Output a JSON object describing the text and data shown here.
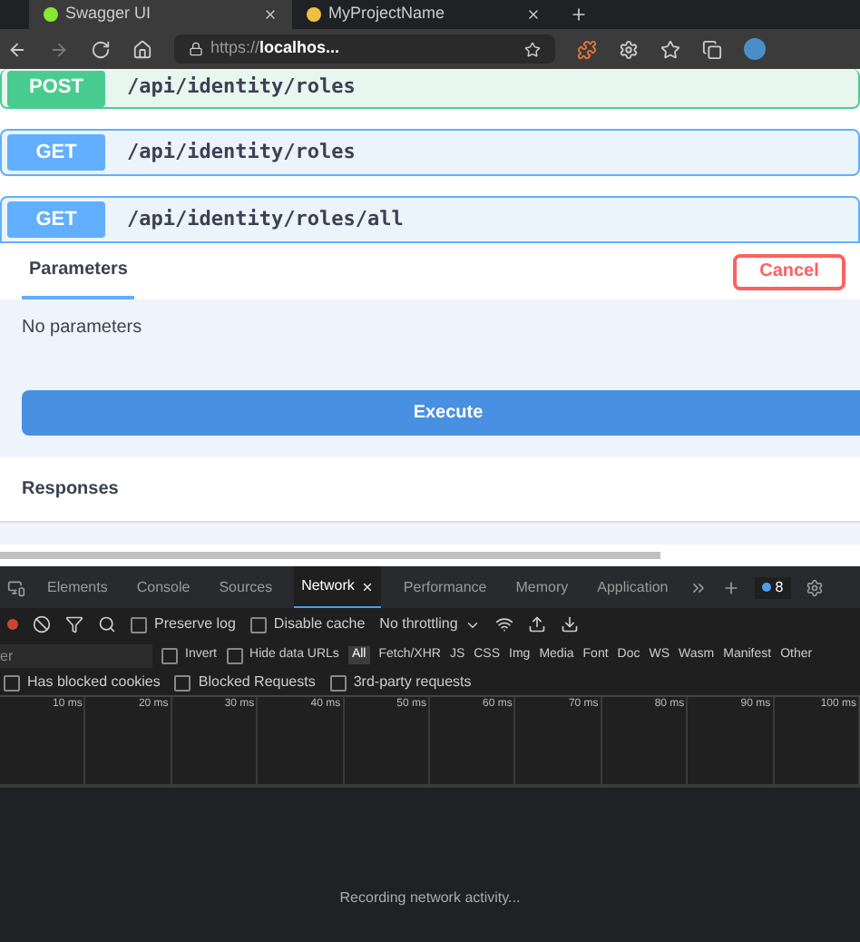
{
  "browser_tabs": [
    {
      "title": "Swagger UI",
      "selected": true
    },
    {
      "title": "MyProjectName",
      "selected": false
    }
  ],
  "address_bar": {
    "url_prefix": "https://",
    "url_host": "localhos..."
  },
  "operations": [
    {
      "method": "POST",
      "path": "/api/identity/roles",
      "expanded": false
    },
    {
      "method": "GET",
      "path": "/api/identity/roles",
      "expanded": false
    },
    {
      "method": "GET",
      "path": "/api/identity/roles/all",
      "expanded": true
    }
  ],
  "operation_panel": {
    "tab": "Parameters",
    "cancel": "Cancel",
    "no_params": "No parameters",
    "execute": "Execute",
    "responses": "Responses"
  },
  "devtools": {
    "tabs": [
      {
        "label": "Elements",
        "selected": false
      },
      {
        "label": "Console",
        "selected": false
      },
      {
        "label": "Sources",
        "selected": false
      },
      {
        "label": "Network",
        "selected": true
      },
      {
        "label": "Performance",
        "selected": false
      },
      {
        "label": "Memory",
        "selected": false
      },
      {
        "label": "Application",
        "selected": false
      }
    ],
    "issues_count": "8",
    "toolbar_checks": [
      {
        "label": "Preserve log",
        "checked": false
      },
      {
        "label": "Disable cache",
        "checked": false
      }
    ],
    "throttling": "No throttling",
    "filter_placeholder": "er",
    "filter_checks": [
      {
        "label": "Invert",
        "checked": false
      },
      {
        "label": "Hide data URLs",
        "checked": false
      }
    ],
    "types": [
      {
        "label": "All",
        "selected": true
      },
      {
        "label": "Fetch/XHR",
        "selected": false
      },
      {
        "label": "JS",
        "selected": false
      },
      {
        "label": "CSS",
        "selected": false
      },
      {
        "label": "Img",
        "selected": false
      },
      {
        "label": "Media",
        "selected": false
      },
      {
        "label": "Font",
        "selected": false
      },
      {
        "label": "Doc",
        "selected": false
      },
      {
        "label": "WS",
        "selected": false
      },
      {
        "label": "Wasm",
        "selected": false
      },
      {
        "label": "Manifest",
        "selected": false
      },
      {
        "label": "Other",
        "selected": false
      }
    ],
    "blocked_checks": [
      {
        "label": "Has blocked cookies",
        "checked": false
      },
      {
        "label": "Blocked Requests",
        "checked": false
      },
      {
        "label": "3rd-party requests",
        "checked": false
      }
    ],
    "ticks": [
      "10 ms",
      "20 ms",
      "30 ms",
      "40 ms",
      "50 ms",
      "60 ms",
      "70 ms",
      "80 ms",
      "90 ms",
      "100 ms"
    ],
    "recording": "Recording network activity..."
  }
}
